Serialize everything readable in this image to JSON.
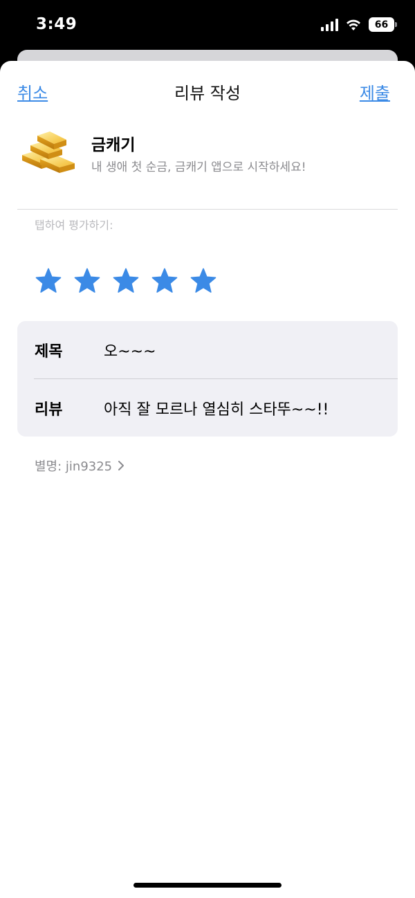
{
  "status_bar": {
    "time": "3:49",
    "battery": "66"
  },
  "nav": {
    "cancel_label": "취소",
    "title": "리뷰 작성",
    "submit_label": "제출"
  },
  "app": {
    "icon": "gold-bars-icon",
    "name": "금캐기",
    "subtitle": "내 생애 첫 순금, 금캐기 앱으로 시작하세요!"
  },
  "rating": {
    "hint": "탭하여 평가하기:",
    "value": 5,
    "max": 5,
    "star_color": "#3b8ae6"
  },
  "form": {
    "title_label": "제목",
    "title_value": "오~~~",
    "review_label": "리뷰",
    "review_value": "아직 잘 모르나 열심히 스타뚜~~!!"
  },
  "nickname": {
    "text": "별명: jin9325"
  },
  "colors": {
    "accent": "#3b8ae6",
    "secondary_text": "#8a8a8e",
    "card_bg": "#f0f0f5"
  }
}
